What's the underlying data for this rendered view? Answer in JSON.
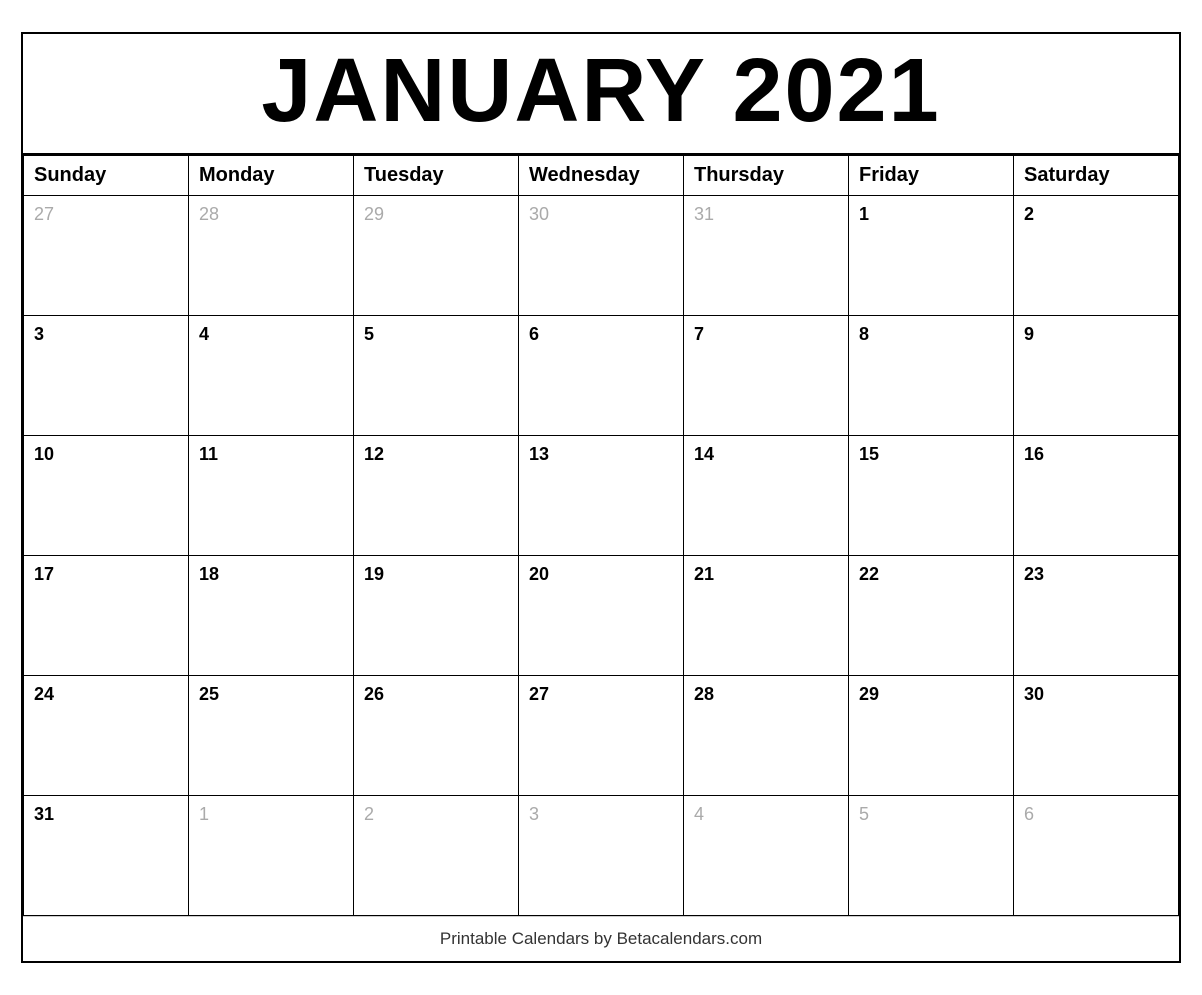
{
  "calendar": {
    "title": "JANUARY 2021",
    "footer": "Printable Calendars by Betacalendars.com",
    "days_of_week": [
      "Sunday",
      "Monday",
      "Tuesday",
      "Wednesday",
      "Thursday",
      "Friday",
      "Saturday"
    ],
    "weeks": [
      [
        {
          "day": "27",
          "other": true
        },
        {
          "day": "28",
          "other": true
        },
        {
          "day": "29",
          "other": true
        },
        {
          "day": "30",
          "other": true
        },
        {
          "day": "31",
          "other": true
        },
        {
          "day": "1",
          "other": false
        },
        {
          "day": "2",
          "other": false
        }
      ],
      [
        {
          "day": "3",
          "other": false
        },
        {
          "day": "4",
          "other": false
        },
        {
          "day": "5",
          "other": false
        },
        {
          "day": "6",
          "other": false
        },
        {
          "day": "7",
          "other": false
        },
        {
          "day": "8",
          "other": false
        },
        {
          "day": "9",
          "other": false
        }
      ],
      [
        {
          "day": "10",
          "other": false
        },
        {
          "day": "11",
          "other": false
        },
        {
          "day": "12",
          "other": false
        },
        {
          "day": "13",
          "other": false
        },
        {
          "day": "14",
          "other": false
        },
        {
          "day": "15",
          "other": false
        },
        {
          "day": "16",
          "other": false
        }
      ],
      [
        {
          "day": "17",
          "other": false
        },
        {
          "day": "18",
          "other": false
        },
        {
          "day": "19",
          "other": false
        },
        {
          "day": "20",
          "other": false
        },
        {
          "day": "21",
          "other": false
        },
        {
          "day": "22",
          "other": false
        },
        {
          "day": "23",
          "other": false
        }
      ],
      [
        {
          "day": "24",
          "other": false
        },
        {
          "day": "25",
          "other": false
        },
        {
          "day": "26",
          "other": false
        },
        {
          "day": "27",
          "other": false
        },
        {
          "day": "28",
          "other": false
        },
        {
          "day": "29",
          "other": false
        },
        {
          "day": "30",
          "other": false
        }
      ],
      [
        {
          "day": "31",
          "other": false
        },
        {
          "day": "1",
          "other": true
        },
        {
          "day": "2",
          "other": true
        },
        {
          "day": "3",
          "other": true
        },
        {
          "day": "4",
          "other": true
        },
        {
          "day": "5",
          "other": true
        },
        {
          "day": "6",
          "other": true
        }
      ]
    ]
  }
}
